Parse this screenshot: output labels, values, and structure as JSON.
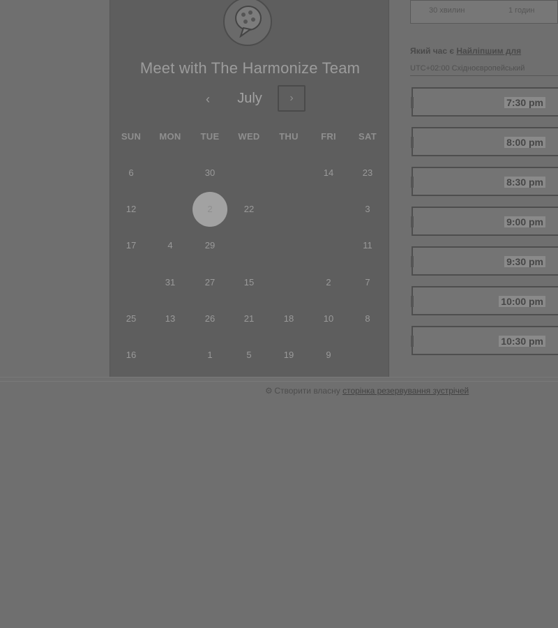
{
  "booking": {
    "title": "Meet with The Harmonize Team",
    "month": "July",
    "prev_label": "‹",
    "next_label": "›",
    "weekdays": [
      "SUN",
      "MON",
      "TUE",
      "WED",
      "THU",
      "FRI",
      "SAT"
    ],
    "days": [
      {
        "label": "6",
        "col": 0,
        "row": 0
      },
      {
        "label": "30",
        "col": 2,
        "row": 0
      },
      {
        "label": "14",
        "col": 5,
        "row": 0
      },
      {
        "label": "23",
        "col": 6,
        "row": 0
      },
      {
        "label": "12",
        "col": 0,
        "row": 1
      },
      {
        "label": "2",
        "col": 2,
        "row": 1,
        "selected": true
      },
      {
        "label": "22",
        "col": 3,
        "row": 1
      },
      {
        "label": "3",
        "col": 6,
        "row": 1
      },
      {
        "label": "17",
        "col": 0,
        "row": 2
      },
      {
        "label": "4",
        "col": 1,
        "row": 2
      },
      {
        "label": "29",
        "col": 2,
        "row": 2
      },
      {
        "label": "11",
        "col": 6,
        "row": 2
      },
      {
        "label": "31",
        "col": 1,
        "row": 3
      },
      {
        "label": "27",
        "col": 2,
        "row": 3
      },
      {
        "label": "15",
        "col": 3,
        "row": 3
      },
      {
        "label": "2",
        "col": 5,
        "row": 3
      },
      {
        "label": "7",
        "col": 6,
        "row": 3
      },
      {
        "label": "25",
        "col": 0,
        "row": 4
      },
      {
        "label": "13",
        "col": 1,
        "row": 4
      },
      {
        "label": "26",
        "col": 2,
        "row": 4
      },
      {
        "label": "21",
        "col": 3,
        "row": 4
      },
      {
        "label": "18",
        "col": 4,
        "row": 4
      },
      {
        "label": "10",
        "col": 5,
        "row": 4
      },
      {
        "label": "8",
        "col": 6,
        "row": 4
      },
      {
        "label": "16",
        "col": 0,
        "row": 5
      },
      {
        "label": "1",
        "col": 2,
        "row": 5
      },
      {
        "label": "5",
        "col": 3,
        "row": 5
      },
      {
        "label": "19",
        "col": 4,
        "row": 5
      },
      {
        "label": "9",
        "col": 5,
        "row": 5
      }
    ]
  },
  "durations": [
    "30 хвилин",
    "1 годин"
  ],
  "question": {
    "prefix": "Який час є ",
    "link": "Найліпшим для",
    "timezone": "UTC+02:00 Східноєвропейський"
  },
  "slots": [
    "7:30 pm",
    "8:00 pm",
    "8:30 pm",
    "9:00 pm",
    "9:30 pm",
    "10:00 pm",
    "10:30 pm"
  ],
  "footer": {
    "icon": "⚙",
    "prefix": "Створити власну ",
    "link": "сторінка резервування зустрічей"
  }
}
